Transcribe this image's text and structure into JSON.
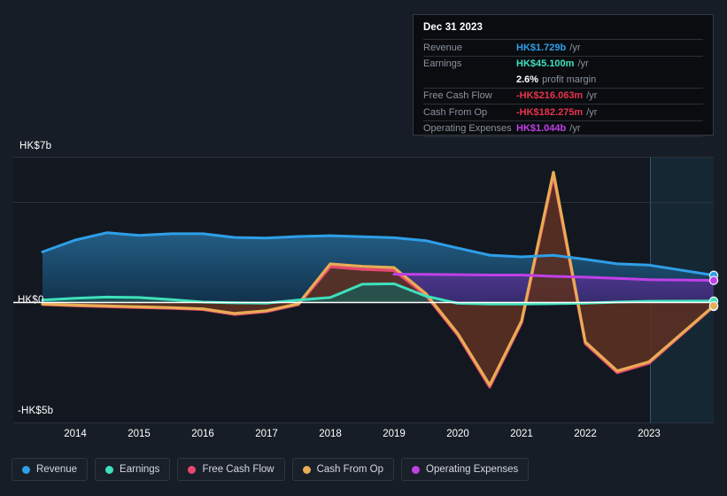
{
  "theme": {
    "background": "#171D26",
    "plot_background": "#131820",
    "zero_line": "#FFFFFF",
    "grid": "#2A313B",
    "forecast_band": "#17303F"
  },
  "tooltip": {
    "date": "Dec 31 2023",
    "rows": [
      {
        "label": "Revenue",
        "value": "HK$1.729b",
        "unit": "/yr",
        "color": "#2E9FE8",
        "sub": ""
      },
      {
        "label": "Earnings",
        "value": "HK$45.100m",
        "unit": "/yr",
        "color": "#3FE0BC",
        "sub": ""
      },
      {
        "label": "",
        "value": "2.6%",
        "unit": "",
        "color": "#FFFFFF",
        "sub": "profit margin"
      },
      {
        "label": "Free Cash Flow",
        "value": "-HK$216.063m",
        "unit": "/yr",
        "color": "#E8334B",
        "sub": ""
      },
      {
        "label": "Cash From Op",
        "value": "-HK$182.275m",
        "unit": "/yr",
        "color": "#E8334B",
        "sub": ""
      },
      {
        "label": "Operating Expenses",
        "value": "HK$1.044b",
        "unit": "/yr",
        "color": "#C040E8",
        "sub": ""
      }
    ]
  },
  "axes": {
    "y_labels": [
      {
        "text": "HK$7b",
        "value": 7
      },
      {
        "text": "HK$0",
        "value": 0
      },
      {
        "text": "-HK$5b",
        "value": -5
      }
    ],
    "x_labels": [
      "2014",
      "2015",
      "2016",
      "2017",
      "2018",
      "2019",
      "2020",
      "2021",
      "2022",
      "2023"
    ]
  },
  "legend": {
    "items": [
      {
        "label": "Revenue",
        "color": "#2E9FE8"
      },
      {
        "label": "Earnings",
        "color": "#3FE0BC"
      },
      {
        "label": "Free Cash Flow",
        "color": "#E8486F"
      },
      {
        "label": "Cash From Op",
        "color": "#E8AC53"
      },
      {
        "label": "Operating Expenses",
        "color": "#C040E8"
      }
    ]
  },
  "chart_data": {
    "type": "area",
    "title": "",
    "xlabel": "",
    "ylabel": "HK$",
    "ylim": [
      -5.9,
      7.0
    ],
    "xlim": [
      2013.5,
      2024.0
    ],
    "grid": true,
    "legend_position": "bottom-left",
    "currency": "HKD",
    "units": "billions",
    "forecast_start": 2023.0,
    "annotations": [
      {
        "text": "Dec 31 2023",
        "x": 2023.0,
        "type": "tooltip-cursor"
      }
    ],
    "x": [
      2013.5,
      2014.0,
      2014.5,
      2015.0,
      2015.5,
      2016.0,
      2016.5,
      2017.0,
      2017.5,
      2018.0,
      2018.5,
      2019.0,
      2019.5,
      2020.0,
      2020.5,
      2021.0,
      2021.5,
      2022.0,
      2022.5,
      2023.0,
      2023.6
    ],
    "series": [
      {
        "name": "Revenue",
        "color": "#2E9FE8",
        "fill": "#1B4565",
        "values": [
          2.42,
          3.0,
          3.35,
          3.22,
          3.3,
          3.3,
          3.12,
          3.1,
          3.18,
          3.22,
          3.17,
          3.12,
          2.98,
          2.62,
          2.28,
          2.2,
          2.27,
          2.08,
          1.86,
          1.8,
          1.73
        ]
      },
      {
        "name": "Earnings",
        "color": "#3FE0BC",
        "fill": "#1F5B54",
        "values": [
          0.1,
          0.18,
          0.24,
          0.22,
          0.12,
          0.0,
          -0.04,
          -0.05,
          0.1,
          0.22,
          0.86,
          0.88,
          0.28,
          -0.06,
          -0.1,
          -0.1,
          -0.08,
          -0.05,
          0.0,
          0.04,
          0.045
        ]
      },
      {
        "name": "Free Cash Flow",
        "color": "#E8486F",
        "fill": "#5C2028",
        "values": [
          -0.12,
          -0.18,
          -0.22,
          -0.26,
          -0.3,
          -0.36,
          -0.6,
          -0.46,
          -0.12,
          1.7,
          1.58,
          1.52,
          0.32,
          -1.6,
          -4.1,
          -1.0,
          6.1,
          -2.0,
          -3.4,
          -2.95,
          -0.216
        ]
      },
      {
        "name": "Cash From Op",
        "color": "#E8AC53",
        "fill": "#5C3A22",
        "values": [
          -0.1,
          -0.15,
          -0.19,
          -0.23,
          -0.27,
          -0.33,
          -0.55,
          -0.42,
          -0.08,
          1.84,
          1.72,
          1.64,
          0.4,
          -1.52,
          -4.0,
          -0.92,
          6.25,
          -1.92,
          -3.32,
          -2.88,
          -0.182
        ]
      },
      {
        "name": "Operating Expenses",
        "color": "#C040E8",
        "fill": "#3A2A6E",
        "start_x": 2019.0,
        "values": [
          null,
          null,
          null,
          null,
          null,
          null,
          null,
          null,
          null,
          null,
          null,
          1.34,
          1.33,
          1.32,
          1.3,
          1.3,
          1.24,
          1.2,
          1.14,
          1.08,
          1.044
        ]
      }
    ]
  }
}
